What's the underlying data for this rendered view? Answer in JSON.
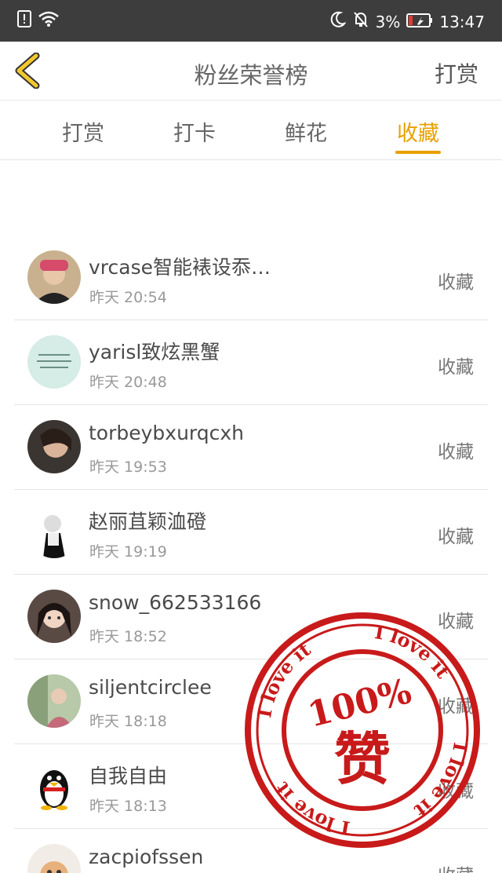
{
  "status_bar": {
    "battery": "3%",
    "time": "13:47"
  },
  "nav": {
    "title": "粉丝荣誉榜",
    "action": "打赏"
  },
  "tabs": [
    {
      "label": "打赏"
    },
    {
      "label": "打卡"
    },
    {
      "label": "鲜花"
    },
    {
      "label": "收藏"
    }
  ],
  "active_tab": 3,
  "colors": {
    "accent": "#e8a000",
    "stamp_red": "#c81a1a",
    "status_bar": "#3d3d3d"
  },
  "list": [
    {
      "name": "vrcase智能裱设忝…",
      "time": "昨天 20:54",
      "action": "收藏"
    },
    {
      "name": "yarisl致炫黑蟹",
      "time": "昨天 20:48",
      "action": "收藏"
    },
    {
      "name": "torbeybxurqcxh",
      "time": "昨天 19:53",
      "action": "收藏"
    },
    {
      "name": "赵丽苴颖洫磴",
      "time": "昨天 19:19",
      "action": "收藏"
    },
    {
      "name": "snow_662533166",
      "time": "昨天 18:52",
      "action": "收藏"
    },
    {
      "name": "siljentcirclee",
      "time": "昨天 18:18",
      "action": "收藏"
    },
    {
      "name": "自我自由",
      "time": "昨天 18:13",
      "action": "收藏"
    },
    {
      "name": "zacpiofssen",
      "time": "",
      "action": "收藏"
    }
  ],
  "stamp": {
    "center_top": "100%",
    "center_char": "赞",
    "ring_text": "I love it"
  }
}
